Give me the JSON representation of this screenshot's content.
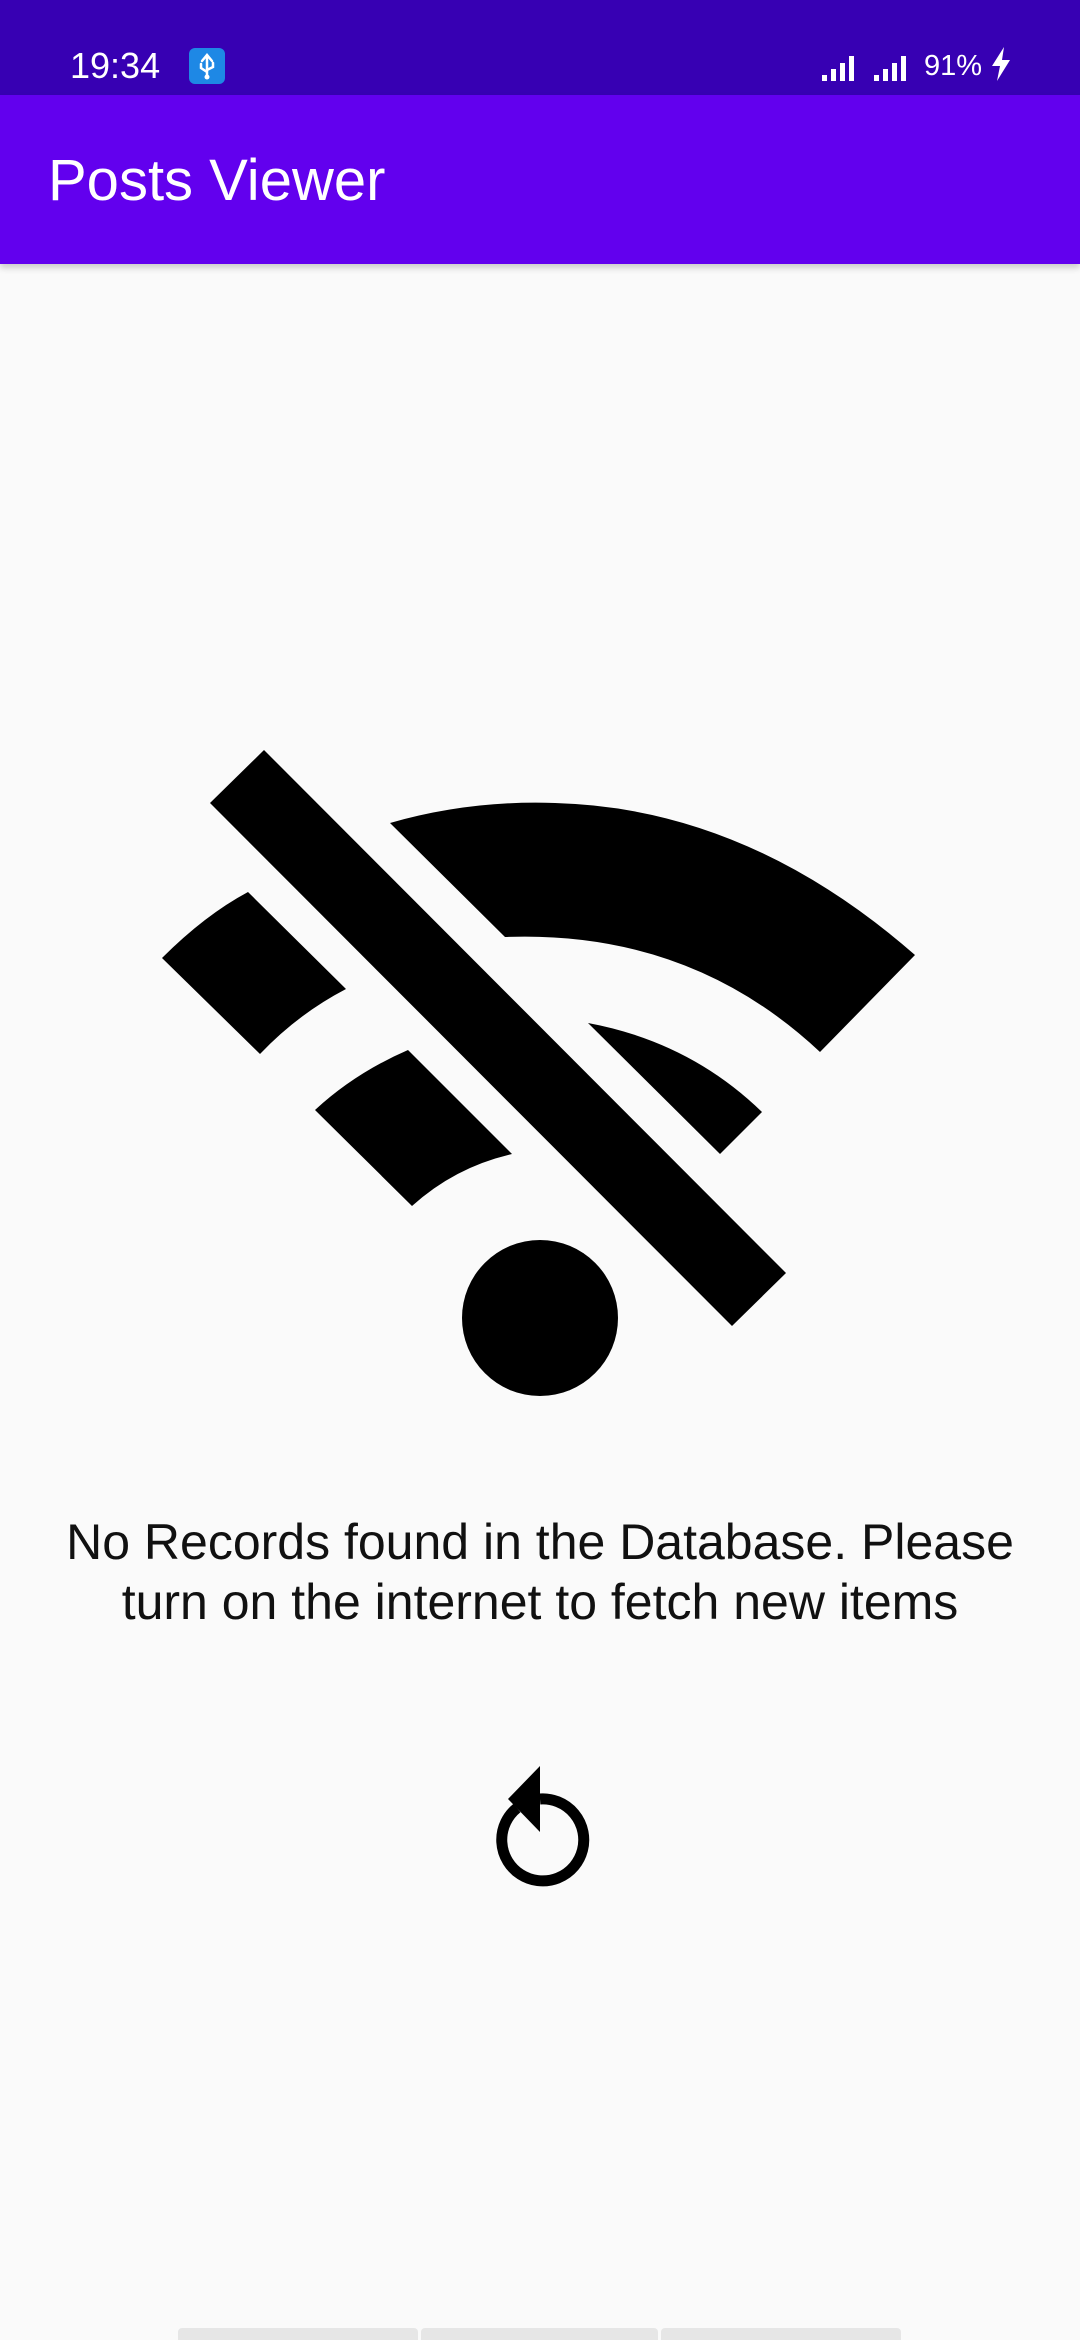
{
  "status_bar": {
    "time": "19:34",
    "battery": "91%",
    "usb_icon": "usb-icon",
    "signal_icon": "signal-icon",
    "charging_icon": "charging-bolt-icon"
  },
  "app_bar": {
    "title": "Posts Viewer"
  },
  "empty_state": {
    "icon": "wifi-off-icon",
    "message": "No Records found in the Database. Please turn on the internet to fetch new items",
    "retry_icon": "refresh-icon"
  },
  "colors": {
    "status_bar": "#3700B3",
    "app_bar": "#6200EE",
    "background": "#FAFAFA",
    "icon": "#000000",
    "usb_badge": "#1E88E5"
  }
}
